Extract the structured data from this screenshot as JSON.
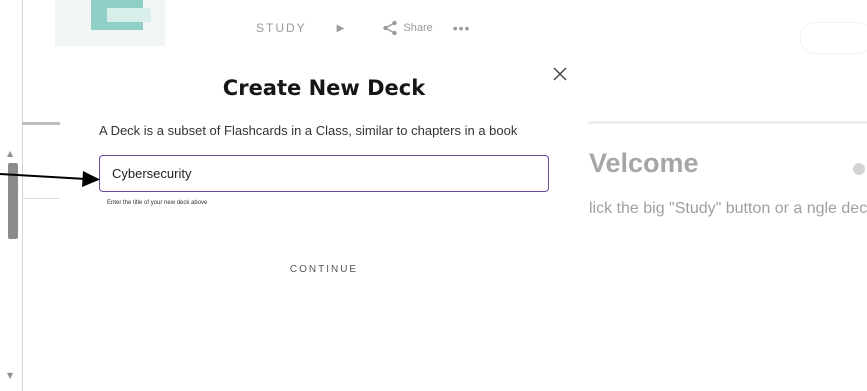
{
  "background": {
    "toolbar": {
      "study_label": "STUDY",
      "play_glyph": "▶",
      "share_label": "Share",
      "more_glyph": "•••",
      "icons": [
        "play-icon",
        "share-icon",
        "more-icon"
      ]
    },
    "welcome_heading": "Velcome",
    "welcome_body": "lick the big \"Study\" button or a ngle deck."
  },
  "modal": {
    "title": "Create New Deck",
    "description": "A Deck is a subset of Flashcards in a Class, similar to chapters in a book",
    "input": {
      "value": "Cybersecurity"
    },
    "hint": "Enter the title of your new deck above",
    "continue_label": "CONTINUE",
    "close_icon": "close-icon"
  },
  "colors": {
    "input_border": "#6d4c99",
    "title": "#161616",
    "background_text": "#a6a6a6",
    "scroll_thumb": "#8c8c8c"
  }
}
